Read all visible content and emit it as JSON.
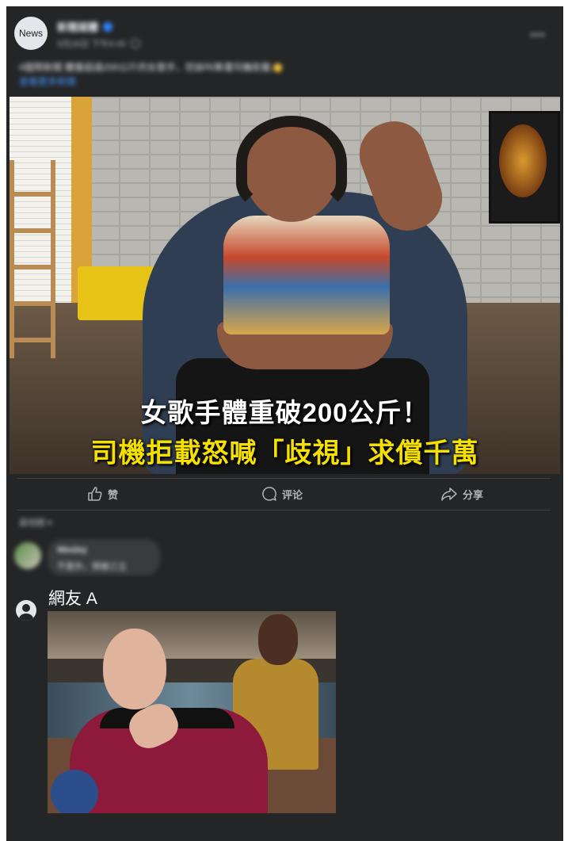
{
  "post": {
    "avatar_label": "News",
    "page_name": "新聞媒體",
    "meta": "5月26日 下午6:45",
    "text": "#國際新聞 體重超過200公斤的女歌手，控訴叫車遭司機拒載",
    "link": "查看更多新聞",
    "more_label": "•••"
  },
  "image": {
    "caption_line1": "女歌手體重破200公斤！",
    "caption_line2": "司機拒載怒喊「歧視」求償千萬"
  },
  "actions": {
    "like_label": "赞",
    "comment_label": "评论",
    "share_label": "分享"
  },
  "comments": {
    "sort_label": "最相關 ▾",
    "first": {
      "name": "Wesley",
      "text": "不意外，想被三立"
    }
  },
  "reply": {
    "name": "網友 A",
    "meme_image": "star-trek-picard-meme"
  },
  "colors": {
    "panel": "#242526",
    "text_primary": "#e4e6eb",
    "text_secondary": "#b0b3b8",
    "link": "#4599ff",
    "caption_yellow": "#f5e000"
  }
}
